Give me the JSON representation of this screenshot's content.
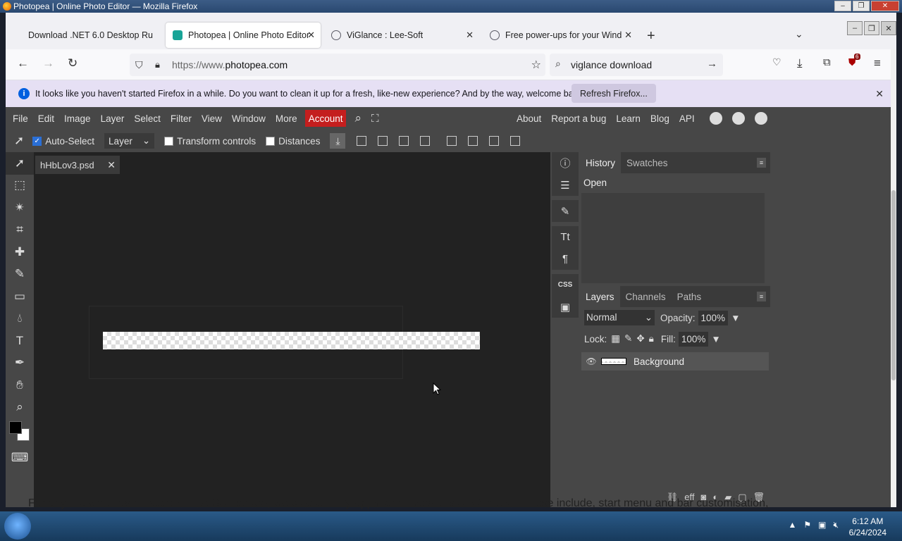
{
  "window": {
    "title": "Photopea | Online Photo Editor — Mozilla Firefox"
  },
  "tabs": [
    {
      "label": "Download .NET 6.0 Desktop Ru"
    },
    {
      "label": "Photopea | Online Photo Editor"
    },
    {
      "label": "ViGlance : Lee-Soft"
    },
    {
      "label": "Free power-ups for your Windo"
    }
  ],
  "nav": {
    "url_prefix": "https://www.",
    "url_domain": "photopea.com",
    "search_value": "viglance download",
    "extension_badge": "6"
  },
  "notice": {
    "message": "It looks like you haven't started Firefox in a while. Do you want to clean it up for a fresh, like-new experience? And by the way, welcome back!",
    "button": "Refresh Firefox..."
  },
  "menu": {
    "items": [
      "File",
      "Edit",
      "Image",
      "Layer",
      "Select",
      "Filter",
      "View",
      "Window",
      "More"
    ],
    "account": "Account",
    "right": [
      "About",
      "Report a bug",
      "Learn",
      "Blog",
      "API"
    ]
  },
  "options": {
    "auto_select": "Auto-Select",
    "layer_select": "Layer",
    "transform": "Transform controls",
    "distances": "Distances"
  },
  "document": {
    "tab": "hHbLov3.psd"
  },
  "panels": {
    "history_tab": "History",
    "swatches_tab": "Swatches",
    "history_items": [
      "Open"
    ],
    "layers_tab": "Layers",
    "channels_tab": "Channels",
    "paths_tab": "Paths",
    "blend_mode": "Normal",
    "opacity_label": "Opacity:",
    "opacity_value": "100%",
    "lock_label": "Lock:",
    "fill_label": "Fill:",
    "fill_value": "100%",
    "layer_name": "Background"
  },
  "page_text": "For anyone who hasn't heard of Lee-Soft before, we create utility apps for all versions of Windows. These include, start menu and bar customisation,",
  "taskbar": {
    "time": "6:12 AM",
    "date": "6/24/2024"
  }
}
